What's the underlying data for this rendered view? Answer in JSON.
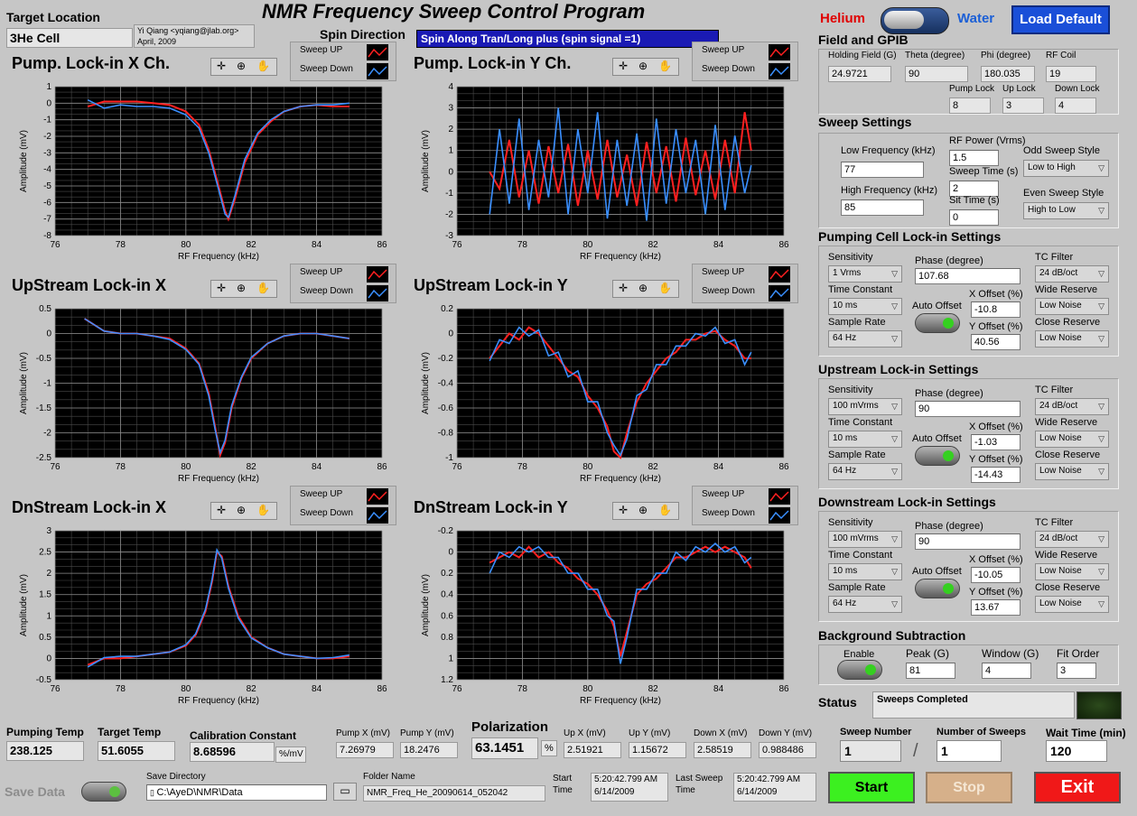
{
  "title": "NMR Frequency Sweep Control Program",
  "target_location": {
    "label": "Target Location",
    "value": "3He Cell"
  },
  "author": {
    "line1": "Yi Qiang <yqiang@jlab.org>",
    "line2": "April, 2009"
  },
  "spin_direction": {
    "label": "Spin Direction",
    "value": "Spin Along Tran/Long plus (spin signal =1)"
  },
  "mode": {
    "left": "Helium",
    "right": "Water",
    "load_default": "Load Default"
  },
  "legend": {
    "up": "Sweep UP",
    "down": "Sweep Down"
  },
  "colors": {
    "up": "#ff2020",
    "down": "#3a8fff"
  },
  "field_gpib": {
    "title": "Field and GPIB",
    "holding_field": {
      "label": "Holding Field (G)",
      "value": "24.9721"
    },
    "theta": {
      "label": "Theta (degree)",
      "value": "90"
    },
    "phi": {
      "label": "Phi (degree)",
      "value": "180.035"
    },
    "rf_coil": {
      "label": "RF Coil",
      "value": "19"
    },
    "pump_lock": {
      "label": "Pump Lock",
      "value": "8"
    },
    "up_lock": {
      "label": "Up Lock",
      "value": "3"
    },
    "down_lock": {
      "label": "Down Lock",
      "value": "4"
    }
  },
  "sweep_settings": {
    "title": "Sweep Settings",
    "low_freq": {
      "label": "Low Frequency (kHz)",
      "value": "77"
    },
    "high_freq": {
      "label": "High Frequency (kHz)",
      "value": "85"
    },
    "rf_power": {
      "label": "RF Power (Vrms)",
      "value": "1.5"
    },
    "sweep_time": {
      "label": "Sweep Time (s)",
      "value": "2"
    },
    "sit_time": {
      "label": "Sit Time (s)",
      "value": "0"
    },
    "odd_style": {
      "label": "Odd Sweep Style",
      "value": "Low to High"
    },
    "even_style": {
      "label": "Even Sweep Style",
      "value": "High to Low"
    }
  },
  "lockins": [
    {
      "title": "Pumping Cell Lock-in Settings",
      "sensitivity": "1 Vrms",
      "time_constant": "10 ms",
      "sample_rate": "64 Hz",
      "phase": "107.68",
      "x_offset": "-10.8",
      "y_offset": "40.56",
      "tc_filter": "24 dB/oct",
      "wide_reserve": "Low Noise",
      "close_reserve": "Low Noise"
    },
    {
      "title": "Upstream Lock-in Settings",
      "sensitivity": "100 mVrms",
      "time_constant": "10 ms",
      "sample_rate": "64 Hz",
      "phase": "90",
      "x_offset": "-1.03",
      "y_offset": "-14.43",
      "tc_filter": "24 dB/oct",
      "wide_reserve": "Low Noise",
      "close_reserve": "Low Noise"
    },
    {
      "title": "Downstream Lock-in Settings",
      "sensitivity": "100 mVrms",
      "time_constant": "10 ms",
      "sample_rate": "64 Hz",
      "phase": "90",
      "x_offset": "-10.05",
      "y_offset": "13.67",
      "tc_filter": "24 dB/oct",
      "wide_reserve": "Low Noise",
      "close_reserve": "Low Noise"
    }
  ],
  "lockin_labels": {
    "sensitivity": "Sensitivity",
    "time_constant": "Time Constant",
    "sample_rate": "Sample Rate",
    "phase": "Phase (degree)",
    "auto_offset": "Auto Offset",
    "x_offset": "X Offset (%)",
    "y_offset": "Y Offset (%)",
    "tc_filter": "TC Filter",
    "wide_reserve": "Wide Reserve",
    "close_reserve": "Close Reserve"
  },
  "background": {
    "title": "Background Subtraction",
    "enable": "Enable",
    "peak_label": "Peak (G)",
    "peak": "81",
    "window_label": "Window (G)",
    "window": "4",
    "fit_label": "Fit Order",
    "fit": "3"
  },
  "status": {
    "label": "Status",
    "value": "Sweeps Completed"
  },
  "bottom": {
    "pumping_temp": {
      "label": "Pumping Temp",
      "value": "238.125"
    },
    "target_temp": {
      "label": "Target Temp",
      "value": "51.6055"
    },
    "calibration": {
      "label": "Calibration Constant",
      "value": "8.68596",
      "unit": "%/mV"
    },
    "pump_x": {
      "label": "Pump X (mV)",
      "value": "7.26979"
    },
    "pump_y": {
      "label": "Pump Y (mV)",
      "value": "18.2476"
    },
    "polarization": {
      "label": "Polarization",
      "value": "63.1451",
      "unit": "%"
    },
    "up_x": {
      "label": "Up X (mV)",
      "value": "2.51921"
    },
    "up_y": {
      "label": "Up Y (mV)",
      "value": "1.15672"
    },
    "down_x": {
      "label": "Down X (mV)",
      "value": "2.58519"
    },
    "down_y": {
      "label": "Down Y (mV)",
      "value": "0.988486"
    },
    "sweep_number": {
      "label": "Sweep Number",
      "value": "1"
    },
    "number_sweeps": {
      "label": "Number of Sweeps",
      "value": "1"
    },
    "wait_time": {
      "label": "Wait Time (min)",
      "value": "120"
    },
    "save_data": "Save Data",
    "save_dir": {
      "label": "Save Directory",
      "value": "C:\\AyeD\\NMR\\Data"
    },
    "folder": {
      "label": "Folder Name",
      "value": "NMR_Freq_He_20090614_052042"
    },
    "start_time": {
      "label": "Start Time",
      "line1": "5:20:42.799 AM",
      "line2": "6/14/2009"
    },
    "last_sweep": {
      "label": "Last Sweep Time",
      "line1": "5:20:42.799 AM",
      "line2": "6/14/2009"
    },
    "start": "Start",
    "stop": "Stop",
    "exit": "Exit"
  },
  "chart_data": [
    {
      "type": "line",
      "title": "Pump. Lock-in X Ch.",
      "xlabel": "RF Frequency (kHz)",
      "ylabel": "Amplitude (mV)",
      "xlim": [
        76,
        86
      ],
      "ylim": [
        -8,
        1
      ],
      "xticks": [
        76,
        78,
        80,
        82,
        84,
        86
      ],
      "yticks": [
        1,
        0,
        -1,
        -2,
        -3,
        -4,
        -5,
        -6,
        -7,
        -8
      ],
      "series": [
        {
          "name": "Sweep UP",
          "x": [
            77,
            77.5,
            78,
            78.5,
            79,
            79.5,
            80,
            80.4,
            80.7,
            81,
            81.2,
            81.3,
            81.5,
            81.8,
            82.2,
            82.6,
            83,
            83.5,
            84,
            84.5,
            85
          ],
          "y": [
            -0.2,
            0.1,
            0.1,
            0.1,
            0,
            -0.1,
            -0.5,
            -1.3,
            -2.8,
            -5,
            -6.5,
            -7,
            -5.8,
            -3.6,
            -1.9,
            -1.1,
            -0.5,
            -0.2,
            -0.1,
            -0.2,
            -0.2
          ]
        },
        {
          "name": "Sweep Down",
          "x": [
            77,
            77.5,
            78,
            78.5,
            79,
            79.5,
            80,
            80.4,
            80.7,
            81,
            81.2,
            81.3,
            81.5,
            81.8,
            82.2,
            82.6,
            83,
            83.5,
            84,
            84.5,
            85
          ],
          "y": [
            0.2,
            -0.3,
            -0.1,
            -0.2,
            -0.2,
            -0.3,
            -0.7,
            -1.5,
            -3,
            -5.2,
            -6.7,
            -6.9,
            -5.6,
            -3.4,
            -1.8,
            -1,
            -0.5,
            -0.2,
            -0.1,
            -0.1,
            0
          ]
        }
      ]
    },
    {
      "type": "line",
      "title": "Pump. Lock-in Y Ch.",
      "xlabel": "RF Frequency (kHz)",
      "ylabel": "Amplitude (mV)",
      "xlim": [
        76,
        86
      ],
      "ylim": [
        -3,
        4
      ],
      "xticks": [
        76,
        78,
        80,
        82,
        84,
        86
      ],
      "yticks": [
        4,
        3,
        2,
        1,
        0,
        -1,
        -2,
        -3
      ],
      "series": [
        {
          "name": "Sweep UP",
          "x": [
            77,
            77.3,
            77.6,
            77.9,
            78.2,
            78.5,
            78.8,
            79.1,
            79.4,
            79.7,
            80,
            80.3,
            80.6,
            80.9,
            81.2,
            81.5,
            81.8,
            82.1,
            82.4,
            82.7,
            83,
            83.3,
            83.6,
            83.9,
            84.2,
            84.5,
            84.8,
            85
          ],
          "y": [
            0,
            -0.8,
            1.5,
            -1.2,
            1,
            -1.5,
            1.2,
            -1,
            1.3,
            -1.6,
            1,
            -1.3,
            1.5,
            -1.2,
            0.8,
            -1.6,
            1.4,
            -1,
            1.2,
            -1.4,
            1.6,
            -1.1,
            1,
            -1.3,
            1.5,
            -1,
            2.8,
            1
          ]
        },
        {
          "name": "Sweep Down",
          "x": [
            77,
            77.3,
            77.6,
            77.9,
            78.2,
            78.5,
            78.8,
            79.1,
            79.4,
            79.7,
            80,
            80.3,
            80.6,
            80.9,
            81.2,
            81.5,
            81.8,
            82.1,
            82.4,
            82.7,
            83,
            83.3,
            83.6,
            83.9,
            84.2,
            84.5,
            84.8,
            85
          ],
          "y": [
            -2,
            2,
            -1.5,
            2.5,
            -1.8,
            1.5,
            -1.2,
            3,
            -2,
            2,
            -1,
            2.8,
            -2.2,
            1.5,
            -1.6,
            1.8,
            -2.3,
            2.5,
            -1.5,
            2,
            -1,
            1.5,
            -2,
            2.2,
            -1.8,
            1.7,
            -1,
            0.3
          ]
        }
      ]
    },
    {
      "type": "line",
      "title": "UpStream Lock-in X",
      "xlabel": "RF Frequency (kHz)",
      "ylabel": "Amplitude (mV)",
      "xlim": [
        76,
        86
      ],
      "ylim": [
        -2.5,
        0.5
      ],
      "xticks": [
        76,
        78,
        80,
        82,
        84,
        86
      ],
      "yticks": [
        0.5,
        0,
        -0.5,
        -1,
        -1.5,
        -2,
        -2.5
      ],
      "series": [
        {
          "name": "Sweep UP",
          "x": [
            76.9,
            77.5,
            78,
            78.5,
            79,
            79.5,
            80,
            80.4,
            80.7,
            80.9,
            81.05,
            81.2,
            81.4,
            81.7,
            82,
            82.5,
            83,
            83.5,
            84,
            84.5,
            85
          ],
          "y": [
            0.3,
            0.05,
            0,
            0,
            -0.05,
            -0.1,
            -0.3,
            -0.6,
            -1.2,
            -1.9,
            -2.45,
            -2.2,
            -1.5,
            -0.9,
            -0.5,
            -0.2,
            -0.05,
            0,
            0,
            -0.05,
            -0.1
          ]
        },
        {
          "name": "Sweep Down",
          "x": [
            76.9,
            77.5,
            78,
            78.5,
            79,
            79.5,
            80,
            80.4,
            80.7,
            80.9,
            81.05,
            81.2,
            81.4,
            81.7,
            82,
            82.5,
            83,
            83.5,
            84,
            84.5,
            85
          ],
          "y": [
            0.3,
            0.05,
            0,
            0,
            -0.05,
            -0.12,
            -0.32,
            -0.62,
            -1.25,
            -1.95,
            -2.4,
            -2.15,
            -1.45,
            -0.88,
            -0.48,
            -0.2,
            -0.05,
            0,
            0,
            -0.05,
            -0.1
          ]
        }
      ]
    },
    {
      "type": "line",
      "title": "UpStream Lock-in Y",
      "xlabel": "RF Frequency (kHz)",
      "ylabel": "Amplitude (mV)",
      "xlim": [
        76,
        86
      ],
      "ylim": [
        -1,
        0.2
      ],
      "xticks": [
        76,
        78,
        80,
        82,
        84,
        86
      ],
      "yticks": [
        0.2,
        0,
        -0.2,
        -0.4,
        -0.6,
        -0.8,
        -1
      ],
      "series": [
        {
          "name": "Sweep UP",
          "x": [
            77,
            77.3,
            77.6,
            77.9,
            78.2,
            78.5,
            78.8,
            79.1,
            79.4,
            79.7,
            80,
            80.3,
            80.6,
            80.8,
            81,
            81.2,
            81.5,
            81.8,
            82.1,
            82.4,
            82.7,
            83,
            83.3,
            83.6,
            83.9,
            84.2,
            84.5,
            84.8,
            85
          ],
          "y": [
            -0.2,
            -0.1,
            0,
            -0.05,
            0.05,
            0,
            -0.1,
            -0.2,
            -0.3,
            -0.35,
            -0.5,
            -0.6,
            -0.75,
            -0.95,
            -1,
            -0.8,
            -0.55,
            -0.4,
            -0.3,
            -0.2,
            -0.15,
            -0.05,
            -0.05,
            0,
            0.02,
            -0.05,
            -0.1,
            -0.2,
            -0.2
          ]
        },
        {
          "name": "Sweep Down",
          "x": [
            77,
            77.3,
            77.6,
            77.9,
            78.2,
            78.5,
            78.8,
            79.1,
            79.4,
            79.7,
            80,
            80.3,
            80.6,
            80.8,
            81,
            81.2,
            81.5,
            81.8,
            82.1,
            82.4,
            82.7,
            83,
            83.3,
            83.6,
            83.9,
            84.2,
            84.5,
            84.8,
            85
          ],
          "y": [
            -0.22,
            -0.05,
            -0.08,
            0.05,
            -0.02,
            0.03,
            -0.18,
            -0.15,
            -0.35,
            -0.3,
            -0.55,
            -0.55,
            -0.8,
            -0.9,
            -0.98,
            -0.85,
            -0.5,
            -0.45,
            -0.25,
            -0.25,
            -0.1,
            -0.1,
            0,
            -0.02,
            0.05,
            -0.08,
            -0.05,
            -0.25,
            -0.15
          ]
        }
      ]
    },
    {
      "type": "line",
      "title": "DnStream Lock-in X",
      "xlabel": "RF Frequency (kHz)",
      "ylabel": "Amplitude (mV)",
      "xlim": [
        76,
        86
      ],
      "ylim": [
        -0.5,
        3
      ],
      "xticks": [
        76,
        78,
        80,
        82,
        84,
        86
      ],
      "yticks": [
        3,
        2.5,
        2,
        1.5,
        1,
        0.5,
        0,
        -0.5
      ],
      "series": [
        {
          "name": "Sweep UP",
          "x": [
            77,
            77.5,
            78,
            78.5,
            79,
            79.5,
            80,
            80.3,
            80.6,
            80.8,
            80.95,
            81.1,
            81.3,
            81.6,
            82,
            82.5,
            83,
            83.5,
            84,
            84.5,
            85
          ],
          "y": [
            -0.15,
            0,
            0,
            0.05,
            0.1,
            0.15,
            0.3,
            0.55,
            1.1,
            1.8,
            2.5,
            2.4,
            1.7,
            1,
            0.5,
            0.25,
            0.1,
            0.05,
            0,
            0,
            0.05
          ]
        },
        {
          "name": "Sweep Down",
          "x": [
            77,
            77.5,
            78,
            78.5,
            79,
            79.5,
            80,
            80.3,
            80.6,
            80.8,
            80.95,
            81.1,
            81.3,
            81.6,
            82,
            82.5,
            83,
            83.5,
            84,
            84.5,
            85
          ],
          "y": [
            -0.2,
            0.02,
            0.05,
            0.05,
            0.1,
            0.15,
            0.32,
            0.58,
            1.15,
            1.85,
            2.55,
            2.35,
            1.65,
            0.95,
            0.48,
            0.25,
            0.1,
            0.05,
            0,
            0.02,
            0.08
          ]
        }
      ]
    },
    {
      "type": "line",
      "title": "DnStream Lock-in Y",
      "xlabel": "RF Frequency (kHz)",
      "ylabel": "Amplitude (mV)",
      "xlim": [
        76,
        86
      ],
      "ylim": [
        -0.2,
        1.2
      ],
      "y_inverted": true,
      "xticks": [
        76,
        78,
        80,
        82,
        84,
        86
      ],
      "yticks": [
        -0.2,
        0,
        0.2,
        0.4,
        0.6,
        0.8,
        1,
        1.2
      ],
      "series": [
        {
          "name": "Sweep UP",
          "x": [
            77,
            77.3,
            77.6,
            77.9,
            78.2,
            78.5,
            78.8,
            79.1,
            79.4,
            79.7,
            80,
            80.3,
            80.6,
            80.8,
            81,
            81.2,
            81.5,
            81.8,
            82.1,
            82.4,
            82.7,
            83,
            83.3,
            83.6,
            83.9,
            84.2,
            84.5,
            84.8,
            85
          ],
          "y": [
            0.1,
            0.05,
            0,
            0.05,
            -0.05,
            0.05,
            0,
            0.1,
            0.15,
            0.25,
            0.3,
            0.4,
            0.55,
            0.7,
            0.98,
            0.75,
            0.4,
            0.3,
            0.25,
            0.15,
            0.05,
            0.05,
            0,
            -0.05,
            0,
            -0.05,
            0,
            0.05,
            0.15
          ]
        },
        {
          "name": "Sweep Down",
          "x": [
            77,
            77.3,
            77.6,
            77.9,
            78.2,
            78.5,
            78.8,
            79.1,
            79.4,
            79.7,
            80,
            80.3,
            80.6,
            80.8,
            81,
            81.2,
            81.5,
            81.8,
            82.1,
            82.4,
            82.7,
            83,
            83.3,
            83.6,
            83.9,
            84.2,
            84.5,
            84.8,
            85
          ],
          "y": [
            0.2,
            0,
            0.05,
            -0.05,
            0,
            -0.05,
            0.05,
            0.05,
            0.2,
            0.2,
            0.35,
            0.35,
            0.6,
            0.65,
            1.05,
            0.8,
            0.35,
            0.35,
            0.2,
            0.2,
            0,
            0.08,
            -0.05,
            0,
            -0.08,
            0,
            -0.05,
            0.1,
            0.05
          ]
        }
      ]
    }
  ]
}
